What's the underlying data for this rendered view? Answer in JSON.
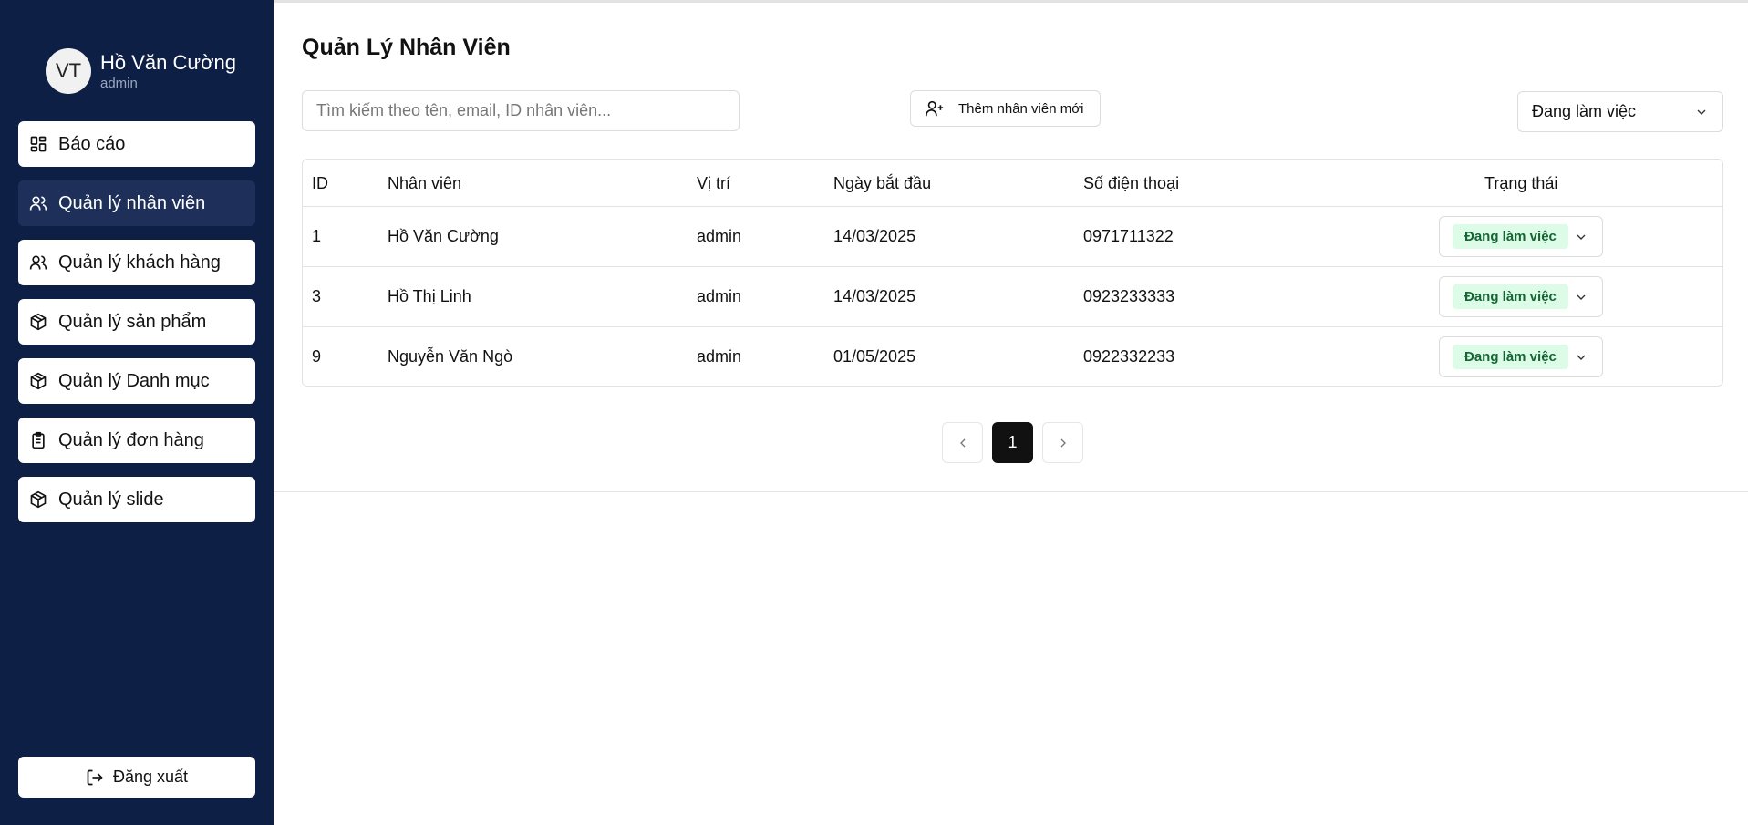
{
  "user": {
    "avatar_initials": "VT",
    "name": "Hồ Văn Cường",
    "role": "admin"
  },
  "sidebar": {
    "items": [
      {
        "label": "Báo cáo",
        "icon": "dashboard-icon",
        "active": false
      },
      {
        "label": "Quản lý nhân viên",
        "icon": "users-icon",
        "active": true
      },
      {
        "label": "Quản lý khách hàng",
        "icon": "users-icon",
        "active": false
      },
      {
        "label": "Quản lý sản phẩm",
        "icon": "package-icon",
        "active": false
      },
      {
        "label": "Quản lý Danh mục",
        "icon": "package-icon",
        "active": false
      },
      {
        "label": "Quản lý đơn hàng",
        "icon": "clipboard-icon",
        "active": false
      },
      {
        "label": "Quản lý slide",
        "icon": "package-icon",
        "active": false
      }
    ],
    "logout_label": "Đăng xuất"
  },
  "main": {
    "title": "Quản Lý Nhân Viên",
    "search_placeholder": "Tìm kiếm theo tên, email, ID nhân viên...",
    "add_button_label": "Thêm nhân viên mới",
    "filter_value": "Đang làm việc",
    "table": {
      "headers": [
        "ID",
        "Nhân viên",
        "Vị trí",
        "Ngày bắt đầu",
        "Số điện thoại",
        "Trạng thái"
      ],
      "rows": [
        {
          "id": "1",
          "name": "Hồ Văn Cường",
          "position": "admin",
          "start_date": "14/03/2025",
          "phone": "0971711322",
          "status": "Đang làm việc"
        },
        {
          "id": "3",
          "name": "Hồ Thị Linh",
          "position": "admin",
          "start_date": "14/03/2025",
          "phone": "0923233333",
          "status": "Đang làm việc"
        },
        {
          "id": "9",
          "name": "Nguyễn Văn Ngò",
          "position": "admin",
          "start_date": "01/05/2025",
          "phone": "0922332233",
          "status": "Đang làm việc"
        }
      ]
    },
    "pagination": {
      "current_page": "1"
    }
  },
  "colors": {
    "sidebar_bg": "#0e1f45",
    "active_item_bg": "#1e305a",
    "badge_bg": "#dcfce7",
    "badge_text": "#166534"
  }
}
